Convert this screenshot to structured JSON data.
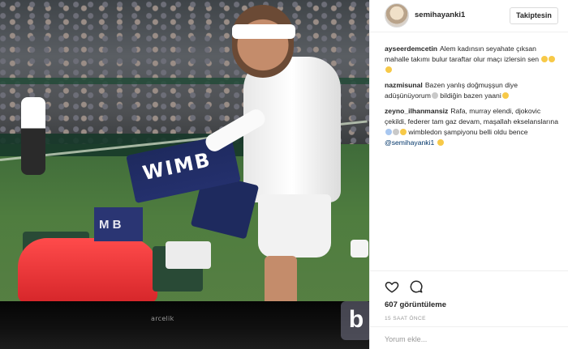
{
  "media": {
    "towel_text": "WIMB",
    "small_towel_text": "M B",
    "tv_brand": "arcelik",
    "watermark": "b"
  },
  "post": {
    "username": "semihayanki1",
    "follow_label": "Takiptesin",
    "views": "607 görüntüleme",
    "time_ago": "15 SAAT ÖNCE",
    "comment_placeholder": "Yorum ekle..."
  },
  "comments": [
    {
      "user": "ayseerdemcetin",
      "text": "Alem kadınsın seyahate çıksan mahalle takımı bulur taraftar olur maçı izlersin sen",
      "emojis": [
        "yellow",
        "yellow",
        "yellow"
      ]
    },
    {
      "user": "nazmisunal",
      "text_1": "Bazen yanlış doğmuşşun diye adüşünüyorum",
      "text_2": "bildiğin bazen yaani",
      "emojis_mid": [
        "grey"
      ],
      "emojis_end": [
        "yellow"
      ]
    },
    {
      "user": "zeyno_ilhanmansiz",
      "text": "Rafa, murray elendi, djokovic çekildi, federer tam gaz devam, maşallah ekselanslarına",
      "text_2": "wimbledon şampiyonu belli oldu bence",
      "mention": "@semihayanki1",
      "emojis_mid": [
        "blue",
        "grey",
        "yellow"
      ],
      "emojis_end": [
        "yellow"
      ]
    }
  ],
  "colors": {
    "username": "#262626",
    "mention": "#003569",
    "meta": "#999999",
    "border": "#efefef"
  },
  "icons": [
    "heart-icon",
    "comment-icon"
  ]
}
